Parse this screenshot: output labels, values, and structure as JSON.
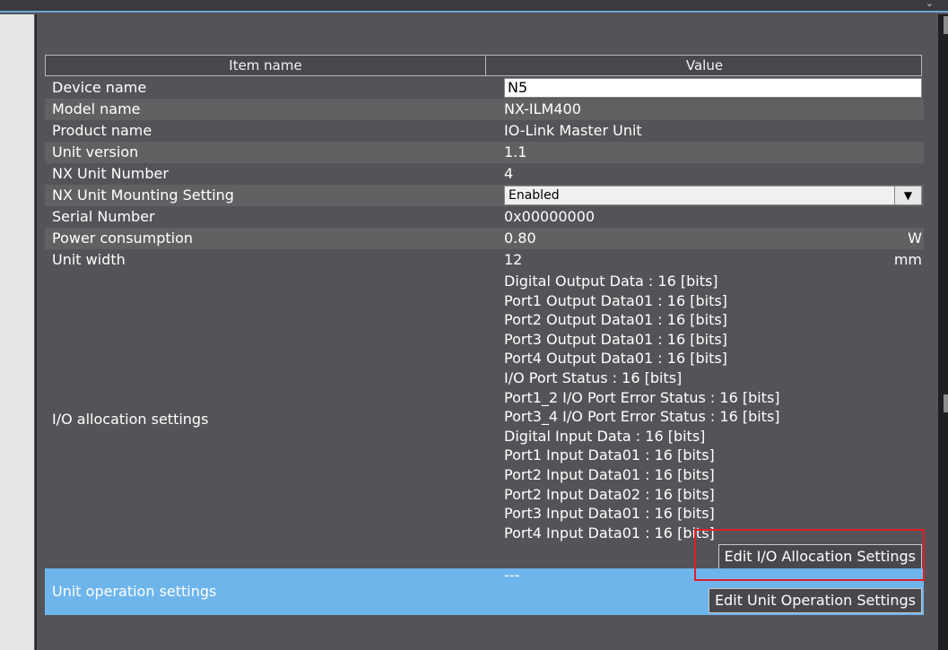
{
  "table": {
    "header_item_name": "Item name",
    "header_value": "Value"
  },
  "rows": {
    "device_name": {
      "label": "Device name",
      "value": "N5"
    },
    "model_name": {
      "label": "Model name",
      "value": "NX-ILM400"
    },
    "product_name": {
      "label": "Product name",
      "value": "IO-Link Master Unit"
    },
    "unit_version": {
      "label": "Unit version",
      "value": "1.1"
    },
    "nx_unit_number": {
      "label": "NX Unit Number",
      "value": "4"
    },
    "mounting_setting": {
      "label": "NX Unit Mounting Setting",
      "value": "Enabled"
    },
    "serial_number": {
      "label": "Serial Number",
      "value": "0x00000000"
    },
    "power_consumption": {
      "label": "Power consumption",
      "value": "0.80",
      "unit": "W"
    },
    "unit_width": {
      "label": "Unit width",
      "value": "12",
      "unit": "mm"
    }
  },
  "io_allocation": {
    "label": "I/O allocation settings",
    "items": [
      "Digital Output Data : 16 [bits]",
      "Port1 Output Data01 : 16 [bits]",
      "Port2 Output Data01 : 16 [bits]",
      "Port3 Output Data01 : 16 [bits]",
      "Port4 Output Data01 : 16 [bits]",
      "I/O Port Status : 16 [bits]",
      "Port1_2 I/O Port Error Status : 16 [bits]",
      "Port3_4 I/O Port Error Status : 16 [bits]",
      "Digital Input Data : 16 [bits]",
      "Port1 Input Data01 : 16 [bits]",
      "Port2 Input Data01 : 16 [bits]",
      "Port2 Input Data02 : 16 [bits]",
      "Port3 Input Data01 : 16 [bits]",
      "Port4 Input Data01 : 16 [bits]"
    ],
    "button_label": "Edit I/O Allocation Settings"
  },
  "unit_operation": {
    "label": "Unit operation settings",
    "value": "---",
    "button_label": "Edit Unit Operation Settings"
  },
  "icons": {
    "dropdown": "▼",
    "topbar_chevron": "⌄"
  },
  "colors": {
    "background": "#545458",
    "row_alt": "#616164",
    "selected_row": "#6eb5ec",
    "highlight_box": "#e01f26",
    "accent_line": "#6aa6d8"
  }
}
